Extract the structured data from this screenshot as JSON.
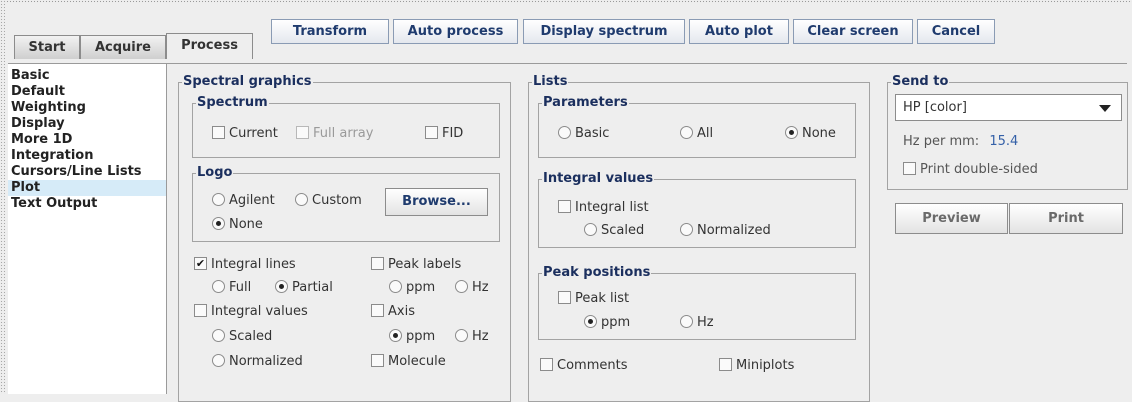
{
  "tabs": {
    "start": "Start",
    "acquire": "Acquire",
    "process": "Process"
  },
  "toolbar": {
    "transform": "Transform",
    "auto_process": "Auto process",
    "display_spectrum": "Display spectrum",
    "auto_plot": "Auto plot",
    "clear_screen": "Clear screen",
    "cancel": "Cancel"
  },
  "sidebar": {
    "items": [
      "Basic",
      "Default",
      "Weighting",
      "Display",
      "More 1D",
      "Integration",
      "Cursors/Line Lists",
      "Plot",
      "Text Output"
    ],
    "selected": "Plot"
  },
  "spectral_graphics": {
    "title": "Spectral graphics",
    "spectrum": {
      "title": "Spectrum",
      "current": "Current",
      "full_array": "Full array",
      "fid": "FID"
    },
    "logo": {
      "title": "Logo",
      "agilent": "Agilent",
      "custom": "Custom",
      "browse": "Browse...",
      "none": "None",
      "selected": "None"
    },
    "integral_lines": {
      "label": "Integral lines",
      "checked": true,
      "full": "Full",
      "partial": "Partial",
      "selected": "Partial"
    },
    "peak_labels": {
      "label": "Peak labels",
      "ppm": "ppm",
      "hz": "Hz"
    },
    "integral_values": {
      "label": "Integral values",
      "scaled": "Scaled",
      "normalized": "Normalized"
    },
    "axis": {
      "label": "Axis",
      "ppm": "ppm",
      "hz": "Hz",
      "selected": "ppm"
    },
    "molecule": "Molecule"
  },
  "lists": {
    "title": "Lists",
    "parameters": {
      "title": "Parameters",
      "basic": "Basic",
      "all": "All",
      "none": "None",
      "selected": "None"
    },
    "integral_values": {
      "title": "Integral values",
      "integral_list": "Integral list",
      "scaled": "Scaled",
      "normalized": "Normalized"
    },
    "peak_positions": {
      "title": "Peak positions",
      "peak_list": "Peak list",
      "ppm": "ppm",
      "hz": "Hz",
      "selected": "ppm"
    },
    "comments": "Comments",
    "miniplots": "Miniplots"
  },
  "send_to": {
    "title": "Send to",
    "printer": "HP [color]",
    "hz_per_mm_label": "Hz per mm:",
    "hz_per_mm_value": "15.4",
    "print_double_sided": "Print double-sided",
    "preview": "Preview",
    "print": "Print"
  },
  "colors": {
    "accent": "#1f3b6e",
    "selection": "#d6ebf8",
    "value": "#3561a8"
  }
}
